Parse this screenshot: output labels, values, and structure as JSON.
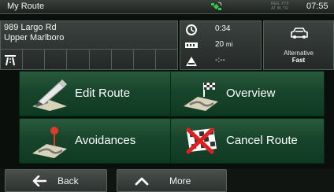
{
  "statusbar": {
    "title": "My Route",
    "time": "07:55",
    "gps_icon": "gps-satellite-icon",
    "small_text": [
      "REG. FT9",
      "AT IN. TR"
    ]
  },
  "route_info": {
    "address_line1": "989 Largo Rd",
    "address_line2": "Upper Marlboro",
    "lane_icon": "motorway-icon",
    "time_remaining": "0:34",
    "distance_value": "20",
    "distance_unit": "mi",
    "arrival_time": "-:--",
    "route_mode_label": "Alternative",
    "route_mode_value": "Fast"
  },
  "menu": {
    "edit_route": "Edit Route",
    "overview": "Overview",
    "avoidances": "Avoidances",
    "cancel_route": "Cancel Route"
  },
  "bottom": {
    "back": "Back",
    "more": "More"
  },
  "colors": {
    "button_green": "#17452b",
    "panel_gray": "#2f3431",
    "text": "#ffffff"
  }
}
